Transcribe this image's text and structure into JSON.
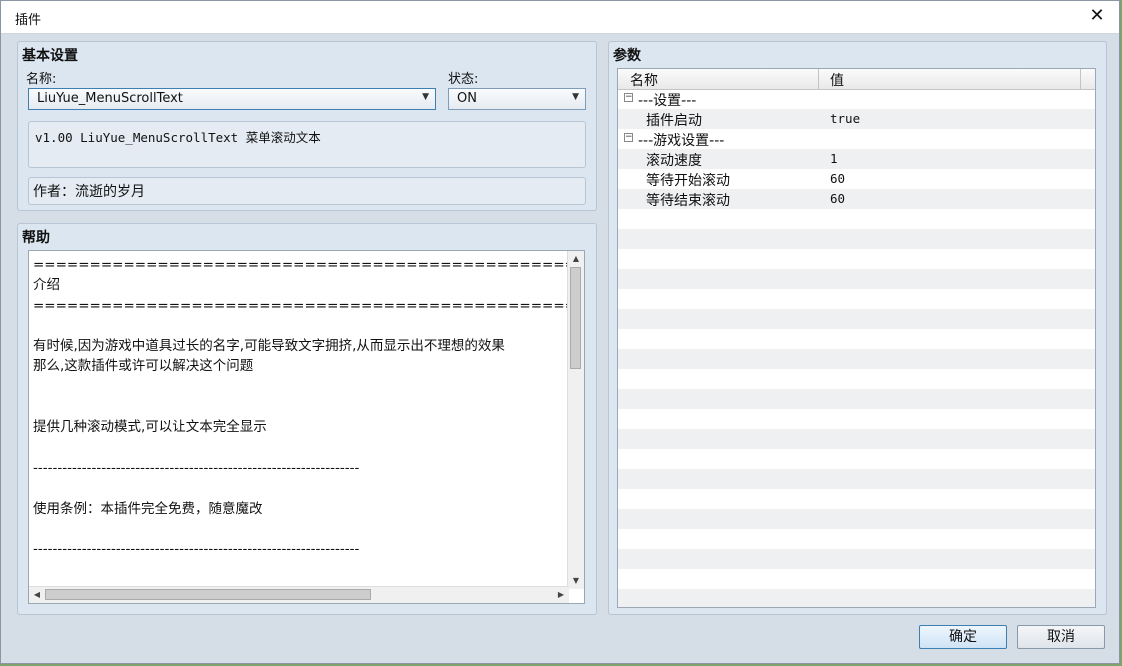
{
  "window": {
    "title": "插件",
    "close_glyph": "✕"
  },
  "basic": {
    "title": "基本设置",
    "name_label": "名称:",
    "name_value": "LiuYue_MenuScrollText",
    "status_label": "状态:",
    "status_value": "ON",
    "description": "v1.00 LiuYue_MenuScrollText 菜单滚动文本",
    "author": "作者：流逝的岁月"
  },
  "help": {
    "title": "帮助",
    "lines": [
      "==========================================================================",
      "介绍",
      "==========================================================================",
      "",
      "有时候,因为游戏中道具过长的名字,可能导致文字拥挤,从而显示出不理想的效果",
      "那么,这款插件或许可以解决这个问题",
      "",
      "",
      "提供几种滚动模式,可以让文本完全显示",
      "",
      "-------------------------------------------------------------------",
      "",
      "使用条例：本插件完全免费，随意魔改",
      "",
      "-------------------------------------------------------------------",
      ""
    ]
  },
  "params": {
    "title": "参数",
    "col_name": "名称",
    "col_value": "值",
    "rows": [
      {
        "name": "---设置---",
        "value": "",
        "group": true
      },
      {
        "name": "插件启动",
        "value": "true",
        "group": false
      },
      {
        "name": "---游戏设置---",
        "value": "",
        "group": true
      },
      {
        "name": "滚动速度",
        "value": "1",
        "group": false
      },
      {
        "name": "等待开始滚动",
        "value": "60",
        "group": false
      },
      {
        "name": "等待结束滚动",
        "value": "60",
        "group": false
      }
    ]
  },
  "buttons": {
    "ok": "确定",
    "cancel": "取消"
  }
}
